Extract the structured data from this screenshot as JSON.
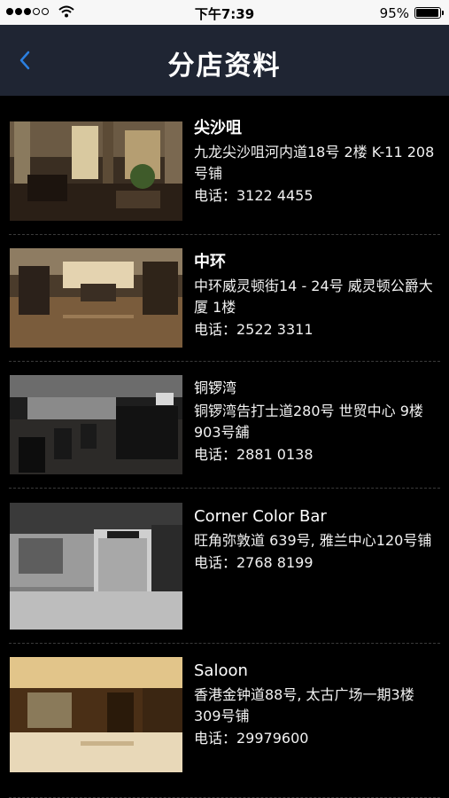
{
  "status_bar": {
    "time": "下午7:39",
    "battery": "95%",
    "battery_level": 0.95
  },
  "nav": {
    "title": "分店资料",
    "back_icon": "chevron-left-icon",
    "accent_color": "#2b7fe0"
  },
  "stores": [
    {
      "name": "尖沙咀",
      "address": "九龙尖沙咀河内道18号 2楼 K-11 208号铺",
      "phone": "电话：3122 4455"
    },
    {
      "name": "中环",
      "address": "中环威灵顿街14 - 24号 威灵顿公爵大厦 1楼",
      "phone": "电话：2522 3311"
    },
    {
      "name": "铜锣湾",
      "address": "铜锣湾告打士道280号 世贸中心 9楼 903号舖",
      "phone": "电话：2881 0138"
    },
    {
      "name": "Corner Color Bar",
      "address": "旺角弥敦道 639号, 雅兰中心120号铺",
      "phone": "电话：2768 8199"
    },
    {
      "name": "Saloon",
      "address": "香港金钟道88号, 太古广场一期3楼309号铺",
      "phone": "电话：29979600"
    }
  ]
}
